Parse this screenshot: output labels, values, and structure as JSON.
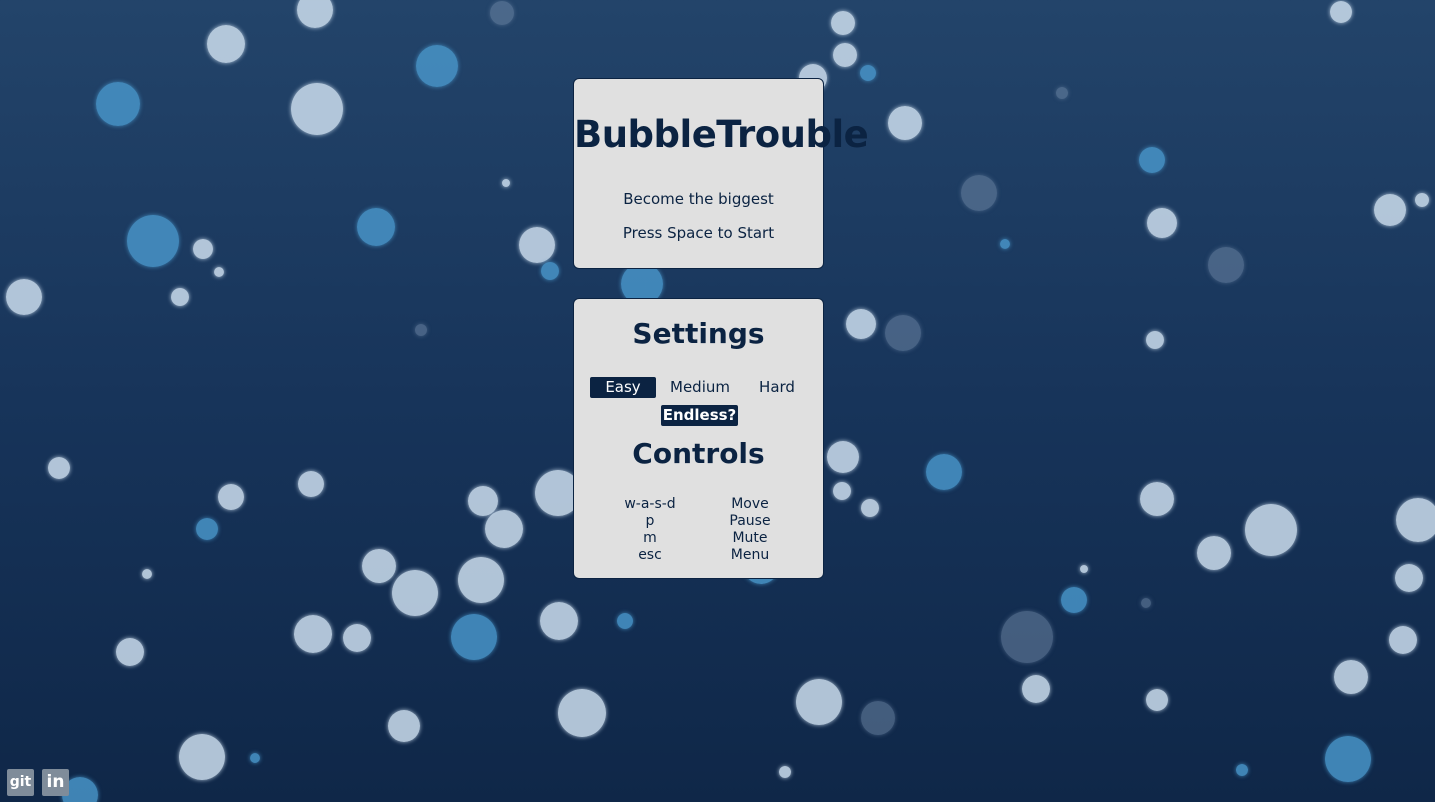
{
  "game": {
    "title": "BubbleTrouble",
    "tagline": "Become the biggest",
    "start_hint": "Press Space to Start"
  },
  "settings": {
    "title": "Settings",
    "difficulty": {
      "options": [
        "Easy",
        "Medium",
        "Hard"
      ],
      "selected": "Easy"
    },
    "endless_label": "Endless?"
  },
  "controls": {
    "title": "Controls",
    "rows": [
      {
        "key": "w-a-s-d",
        "action": "Move"
      },
      {
        "key": "p",
        "action": "Pause"
      },
      {
        "key": "m",
        "action": "Mute"
      },
      {
        "key": "esc",
        "action": "Menu"
      }
    ]
  },
  "links": {
    "git": "git",
    "linkedin": "in"
  },
  "colors": {
    "accent": "#0b2342",
    "panel": "#e0e0e0",
    "background_top": "#23446a",
    "background_bottom": "#0f2748"
  }
}
